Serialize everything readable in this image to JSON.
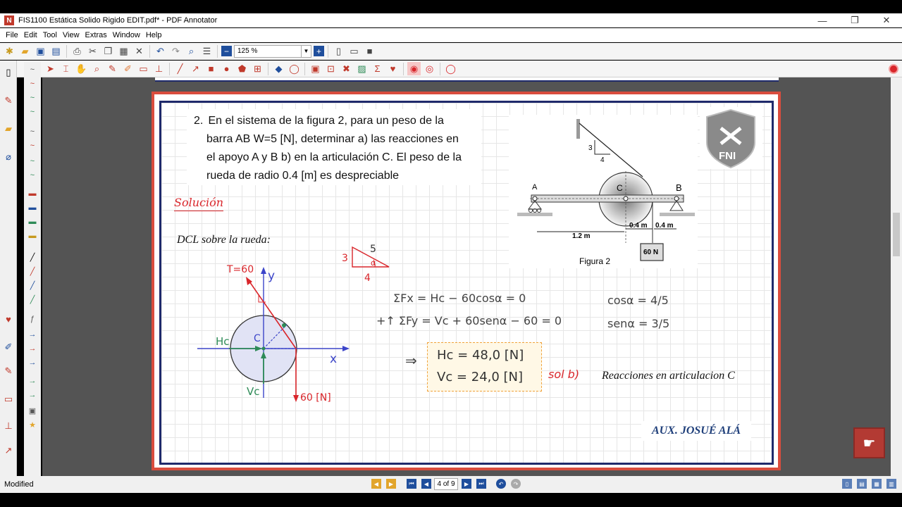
{
  "window": {
    "title": "FIS1100 Estática Solido Rigido EDIT.pdf* - PDF Annotator",
    "minimize": "—",
    "restore": "❐",
    "close": "✕"
  },
  "menu": [
    "File",
    "Edit",
    "Tool",
    "View",
    "Extras",
    "Window",
    "Help"
  ],
  "toolbar": {
    "zoom_value": "125 %"
  },
  "document": {
    "problem_number": "2.",
    "problem_line1": "En el sistema de la figura 2, para un peso de la",
    "problem_line2": "barra AB W=5 [N], determinar a) las  reacciones en",
    "problem_line3": "el apoyo A y B b) en la articulación C. El peso de la",
    "problem_line4": "rueda de radio 0.4 [m] es despreciable",
    "solucion": "Solución",
    "dcl_label": "DCL sobre la rueda:",
    "reacciones_label": "Reacciones en articulacion C",
    "author": "AUX. JOSUÉ ALÁ",
    "logo_text": "FNI",
    "figure": {
      "label_a": "A",
      "label_b": "B",
      "label_c": "C",
      "dim_12": "1.2 m",
      "dim_04a": "0.4 m",
      "dim_04b": "0.4 m",
      "weight": "60 N",
      "caption": "Figura 2",
      "tri_3": "3",
      "tri_4": "4"
    },
    "dcl": {
      "tension": "T=60",
      "y_axis": "y",
      "x_axis": "x",
      "hc": "Hc",
      "vc": "Vc",
      "c": "C",
      "load": "60 [N]"
    },
    "triangle": {
      "side3": "3",
      "side4": "4",
      "side5": "5",
      "angle": "α"
    },
    "equations": {
      "sum_fx": "ΣFx = Hc − 60cosα = 0",
      "sum_fy": "+↑ ΣFy = Vc + 60senα − 60 = 0",
      "cos": "cosα = 4/5",
      "sen": "senα = 3/5",
      "hc_result": "Hc = 48,0   [N]",
      "vc_result": "Vc = 24,0   [N]",
      "sol": "sol b)"
    }
  },
  "status": {
    "text": "Modified",
    "page_indicator": "4 of 9"
  }
}
